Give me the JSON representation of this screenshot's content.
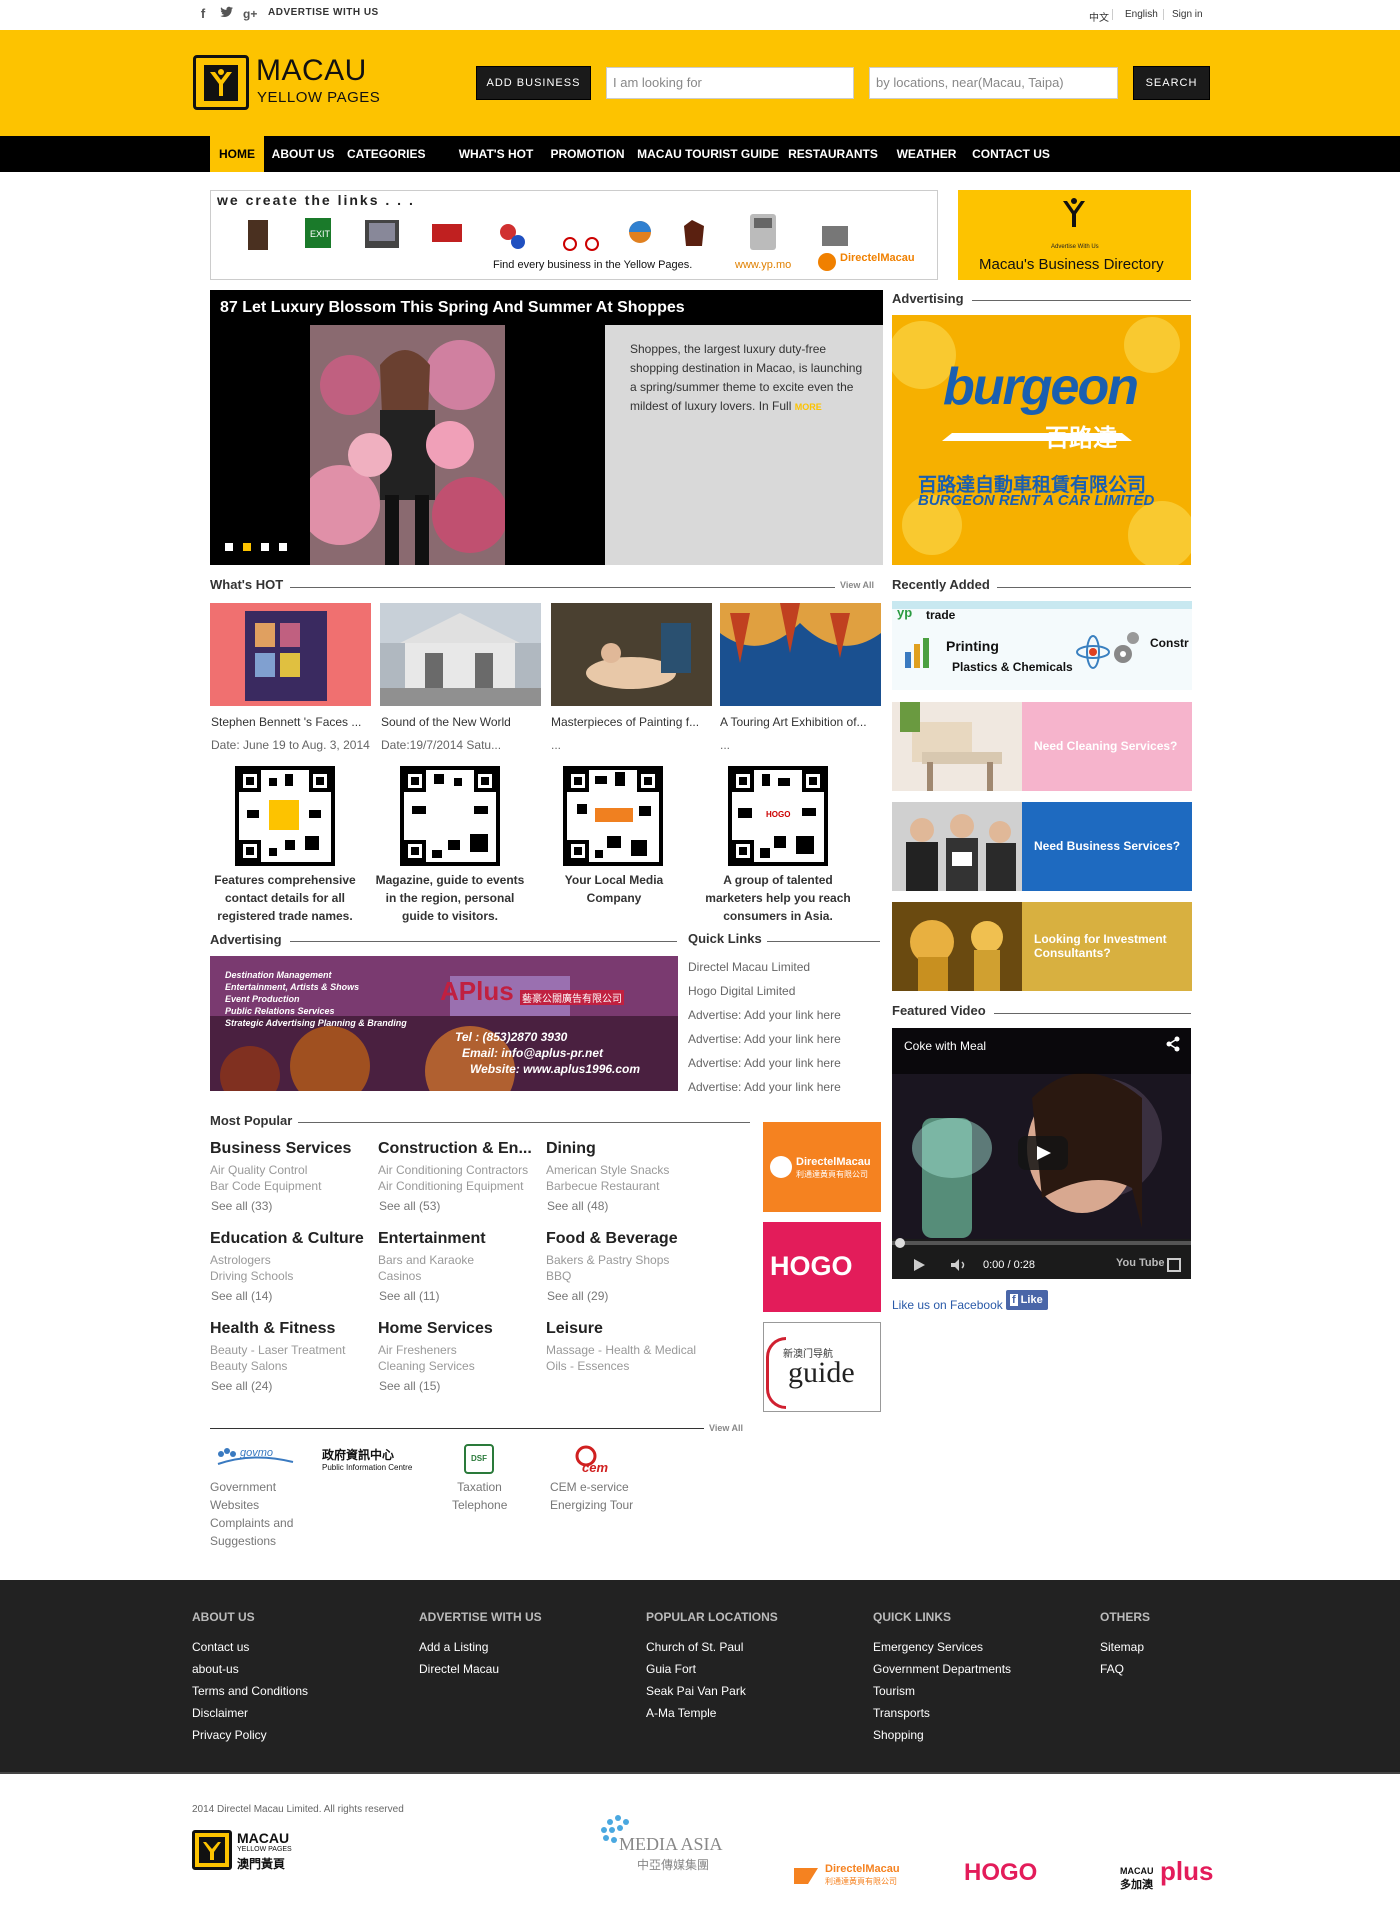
{
  "topbar": {
    "advertise": "ADVERTISE WITH US",
    "lang_zh": "中文",
    "lang_en": "English",
    "signin": "Sign in",
    "social_icons": [
      "facebook-icon",
      "twitter-icon",
      "google-plus-icon"
    ]
  },
  "header": {
    "logo_title": "MACAU",
    "logo_sub": "YELLOW PAGES",
    "add_business": "ADD BUSINESS",
    "search_placeholder": "I am looking for",
    "location_placeholder": "by locations, near(Macau, Taipa)",
    "search_button": "SEARCH",
    "accent_color": "#fdc300"
  },
  "nav": {
    "items": [
      "HOME",
      "ABOUT US",
      "CATEGORIES",
      "WHAT'S HOT",
      "PROMOTION",
      "MACAU TOURIST GUIDE",
      "RESTAURANTS",
      "WEATHER",
      "CONTACT US"
    ]
  },
  "banner": {
    "tagline": "we create the links . . .",
    "find_text": "Find every business in the Yellow Pages.",
    "url": "www.yp.mo",
    "brand": "DirectelMacau",
    "ad_small": "Advertise With Us",
    "ad_title": "Macau's Business Directory"
  },
  "feature": {
    "title": "87 Let Luxury Blossom This Spring And Summer At Shoppes",
    "text": "Shoppes, the largest luxury duty-free shopping destination in Macao, is launching a spring/summer theme to excite even the mildest of luxury lovers. In Full",
    "more": "MORE"
  },
  "advertising_right": {
    "title": "Advertising",
    "brand": "burgeon",
    "brand_cn": "百路達",
    "company_cn": "百路達自動車租賃有限公司",
    "company_en": "BURGEON RENT A CAR LIMITED"
  },
  "whats_hot": {
    "title": "What's HOT",
    "view_all": "View All",
    "items": [
      {
        "caption": "Stephen Bennett 's Faces ...",
        "sub": "Date: June 19 to Aug. 3, 2014"
      },
      {
        "caption": "Sound of the New World",
        "sub": "Date:19/7/2014 Satu..."
      },
      {
        "caption": "Masterpieces of Painting f...",
        "sub": "..."
      },
      {
        "caption": "A Touring Art Exhibition of...",
        "sub": "..."
      }
    ]
  },
  "qr_codes": [
    "Features comprehensive contact details for all registered trade names.",
    "Magazine, guide to events in the region, personal guide to visitors.",
    "Your Local Media Company",
    "A group of talented marketers help you reach consumers in Asia."
  ],
  "advertising_left": {
    "title": "Advertising",
    "lines": [
      "Destination Management",
      "Entertainment, Artists & Shows",
      "Event Production",
      "Public Relations Services",
      "Strategic Advertising Planning & Branding"
    ],
    "brand": "APlus",
    "brand_cn": "藝豪公關廣告有限公司",
    "tel": "Tel : (853)2870 3930",
    "email": "Email: info@aplus-pr.net",
    "website": "Website: www.aplus1996.com"
  },
  "quick_links": {
    "title": "Quick Links",
    "items": [
      "Directel Macau Limited",
      "Hogo Digital Limited",
      "Advertise: Add your link here",
      "Advertise: Add your link here",
      "Advertise: Add your link here",
      "Advertise: Add your link here"
    ]
  },
  "recently_added": {
    "title": "Recently Added",
    "ypt": "trade",
    "printing": "Printing",
    "plastics": "Plastics & Chemicals",
    "constr": "Constr",
    "cleaning": "Need Cleaning Services?",
    "business": "Need Business Services?",
    "investment": "Looking for Investment Consultants?"
  },
  "most_popular": {
    "title": "Most Popular",
    "categories": [
      {
        "name": "Business Services",
        "items": [
          "Air Quality Control",
          "Bar Code Equipment"
        ],
        "see": "See all (33)"
      },
      {
        "name": "Construction & En...",
        "items": [
          "Air Conditioning Contractors",
          "Air Conditioning Equipment"
        ],
        "see": "See all (53)"
      },
      {
        "name": "Dining",
        "items": [
          "American Style Snacks",
          "Barbecue Restaurant"
        ],
        "see": "See all (48)"
      },
      {
        "name": "Education & Culture",
        "items": [
          "Astrologers",
          "Driving Schools"
        ],
        "see": "See all (14)"
      },
      {
        "name": "Entertainment",
        "items": [
          "Bars and Karaoke",
          "Casinos"
        ],
        "see": "See all (11)"
      },
      {
        "name": "Food & Beverage",
        "items": [
          "Bakers & Pastry Shops",
          "BBQ"
        ],
        "see": "See all (29)"
      },
      {
        "name": "Health & Fitness",
        "items": [
          "Beauty - Laser Treatment",
          "Beauty Salons"
        ],
        "see": "See all (24)"
      },
      {
        "name": "Home Services",
        "items": [
          "Air Fresheners",
          "Cleaning Services"
        ],
        "see": "See all (15)"
      },
      {
        "name": "Leisure",
        "items": [
          "Massage - Health & Medical",
          "Oils - Essences"
        ],
        "see": ""
      }
    ]
  },
  "side_ads": {
    "directel": "DirectelMacau",
    "directel_cn": "利通達黃頁有限公司",
    "hogo": "HOGO",
    "guide_cn": "新澳门导航",
    "guide": "guide"
  },
  "video": {
    "title": "Featured Video",
    "name": "Coke with Meal",
    "time": "0:00 / 0:28",
    "youtube": "You Tube",
    "like_text": "Like us on Facebook",
    "like_btn": "Like"
  },
  "links_row": {
    "view_all": "View All",
    "logo1": "govmo",
    "logo2_cn": "政府資訊中心",
    "logo2_en": "Public Information Centre",
    "logo3": "DSF",
    "logo4": "cem",
    "col1": [
      "Government",
      "Websites",
      "Complaints and",
      "Suggestions"
    ],
    "col3": [
      "Taxation",
      "Telephone"
    ],
    "col4": [
      "CEM e-service",
      "Energizing Tour"
    ]
  },
  "footer": {
    "columns": [
      {
        "title": "ABOUT US",
        "links": [
          "Contact us",
          "about-us",
          "Terms and Conditions",
          "Disclaimer",
          "Privacy Policy"
        ]
      },
      {
        "title": "ADVERTISE WITH US",
        "links": [
          "Add a Listing",
          "Directel Macau"
        ]
      },
      {
        "title": "POPULAR LOCATIONS",
        "links": [
          "Church of St. Paul",
          "Guia Fort",
          "Seak Pai Van Park",
          "A-Ma Temple"
        ]
      },
      {
        "title": "QUICK LINKS",
        "links": [
          "Emergency Services",
          "Government Departments",
          "Tourism",
          "Transports",
          "Shopping"
        ]
      },
      {
        "title": "OTHERS",
        "links": [
          "Sitemap",
          "FAQ"
        ]
      }
    ],
    "copyright": "2014 Directel Macau Limited. All rights reserved",
    "logo_title": "MACAU",
    "logo_sub": "YELLOW PAGES",
    "logo_cn": "澳門黃頁",
    "media_asia": "MEDIA ASIA",
    "media_asia_cn": "中亞傳媒集團",
    "directel": "DirectelMacau",
    "directel_cn": "利通達黃頁有限公司",
    "hogo": "HOGO",
    "plus": "plus",
    "plus_cn": "多加澳",
    "plus_macau": "MACAU"
  }
}
